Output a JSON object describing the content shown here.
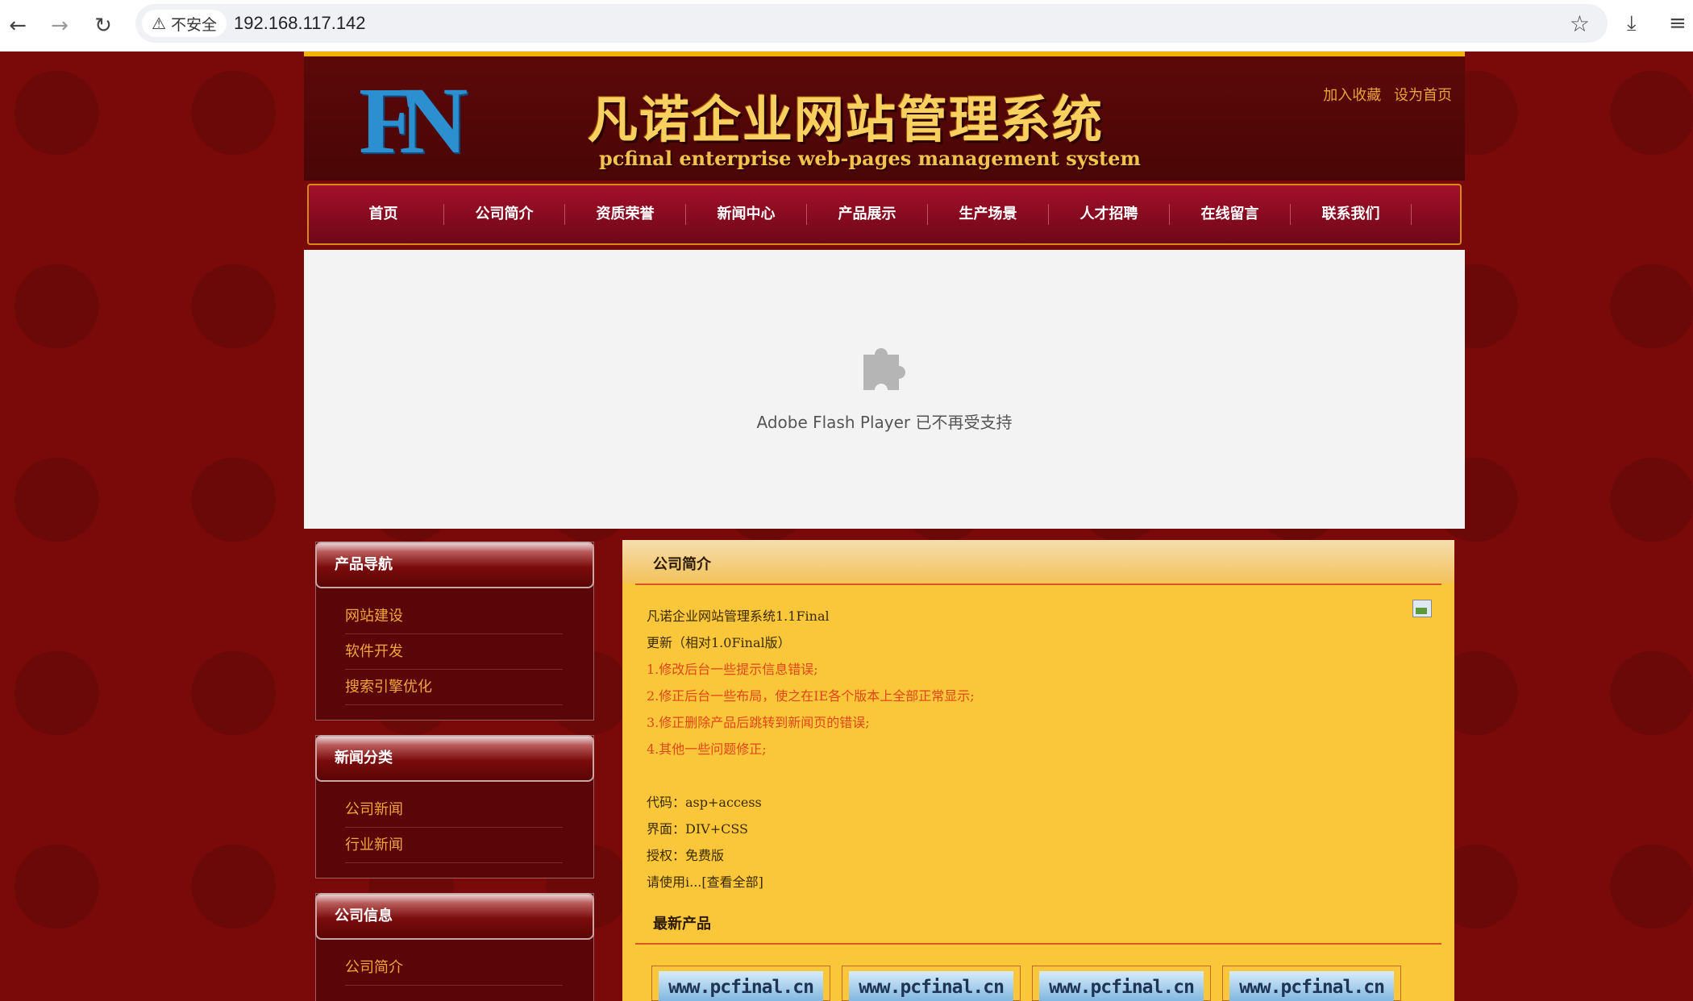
{
  "browser": {
    "security_label": "不安全",
    "url": "192.168.117.142"
  },
  "header": {
    "logo_letters": "FN",
    "site_title": "凡诺企业网站管理系统",
    "site_subtitle": "pcfinal enterprise web-pages management system",
    "top_links": [
      "加入收藏",
      "设为首页"
    ]
  },
  "nav": {
    "items": [
      "首页",
      "公司简介",
      "资质荣誉",
      "新闻中心",
      "产品展示",
      "生产场景",
      "人才招聘",
      "在线留言",
      "联系我们"
    ]
  },
  "flash": {
    "message": "Adobe Flash Player 已不再受支持"
  },
  "sidebar": {
    "product_nav": {
      "title": "产品导航",
      "items": [
        "网站建设",
        "软件开发",
        "搜索引擎优化"
      ]
    },
    "news_categories": {
      "title": "新闻分类",
      "items": [
        "公司新闻",
        "行业新闻"
      ]
    },
    "company_info": {
      "title": "公司信息",
      "items": [
        "公司简介"
      ]
    }
  },
  "main": {
    "about_title": "公司简介",
    "about_lines": [
      "凡诺企业网站管理系统1.1Final",
      "更新（相对1.0Final版）",
      "1.修改后台一些提示信息错误;",
      "2.修正后台一些布局，使之在IE各个版本上全部正常显示;",
      "3.修正删除产品后跳转到新闻页的错误;",
      "4.其他一些问题修正;",
      "",
      "代码：asp+access",
      "界面：DIV+CSS",
      "授权：免费版",
      "请使用i...[查看全部]"
    ],
    "latest_products_title": "最新产品",
    "products": [
      "www.pcfinal.cn",
      "www.pcfinal.cn",
      "www.pcfinal.cn",
      "www.pcfinal.cn"
    ]
  },
  "colors": {
    "page_bg": "#7a0a0a",
    "header_bg": "#4a0606",
    "accent_gold": "#f0b400",
    "nav_bg": "#8a0d22",
    "content_bg": "#fbc73a",
    "side_link": "#f0a63c",
    "notice_red": "#e0461a"
  },
  "icons": {
    "back": "arrow-left-icon",
    "forward": "arrow-right-icon",
    "reload": "reload-icon",
    "warning": "warning-icon",
    "bookmark": "star-icon",
    "download": "download-icon",
    "reading_list": "reading-list-icon",
    "plugin": "puzzle-icon"
  }
}
